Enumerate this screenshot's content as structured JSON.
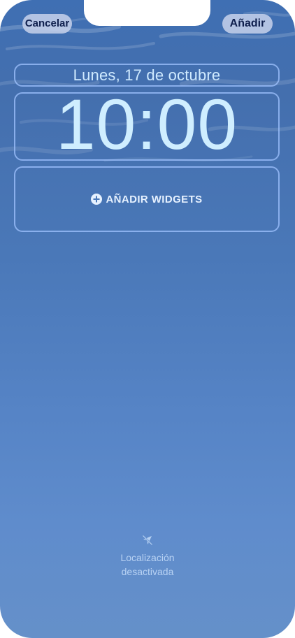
{
  "header": {
    "cancel_label": "Cancelar",
    "add_label": "Añadir"
  },
  "lockscreen": {
    "date": "Lunes, 17 de octubre",
    "time": "10:00",
    "widgets_label": "AÑADIR WIDGETS"
  },
  "footer": {
    "location_line1": "Localización",
    "location_line2": "desactivada",
    "location_icon": "location-off-icon"
  },
  "colors": {
    "sky_top": "#3f6fb3",
    "sky_bottom": "#6590c9",
    "frame_border": "#a0c3ff",
    "button_bg": "#c8d2eb",
    "button_text": "#0f1f4d"
  }
}
